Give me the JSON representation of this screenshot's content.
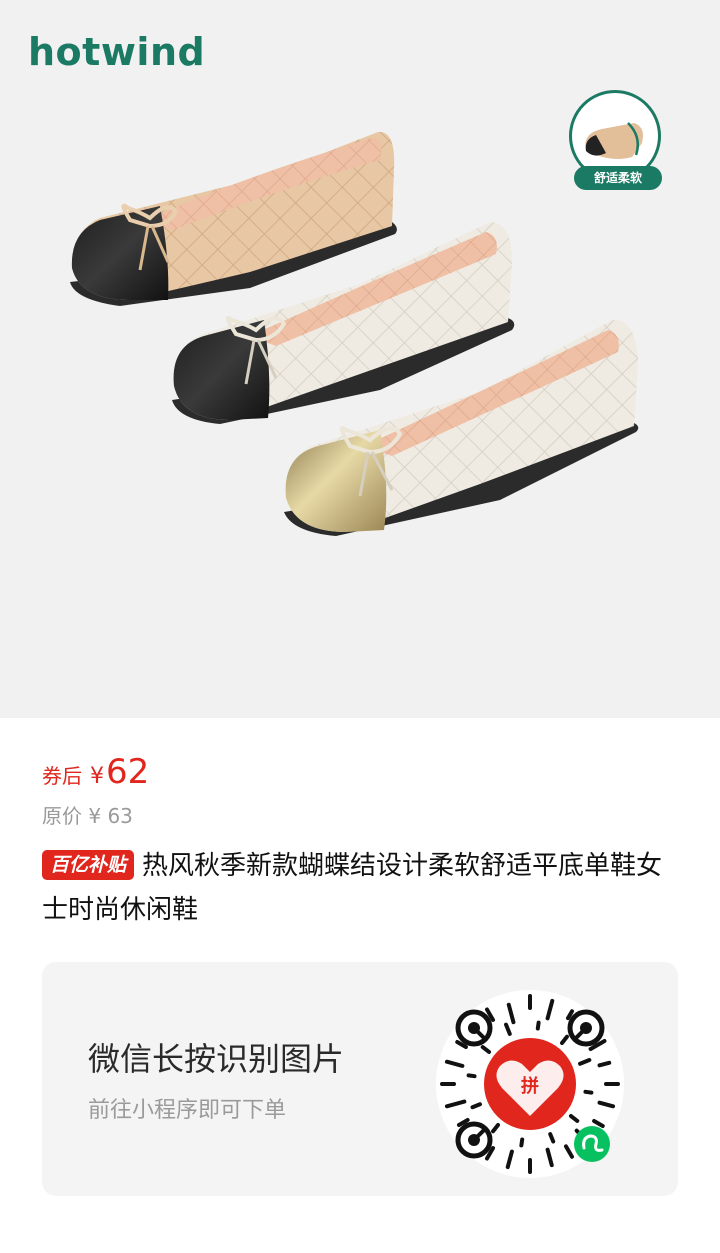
{
  "hero": {
    "brand": "hotwind",
    "feature_badge": "舒适柔软"
  },
  "price": {
    "coupon_label": "券后",
    "currency": "¥",
    "value": "62",
    "original_label": "原价 ¥ 63"
  },
  "product": {
    "badge": "百亿补贴",
    "title": "热风秋季新款蝴蝶结设计柔软舒适平底单鞋女士时尚休闲鞋"
  },
  "mini_program": {
    "title": "微信长按识别图片",
    "subtitle": "前往小程序即可下单",
    "qr_center_char": "拼"
  },
  "colors": {
    "brand_green": "#1b7a63",
    "price_red": "#e0261d",
    "wechat_green": "#07c160"
  }
}
